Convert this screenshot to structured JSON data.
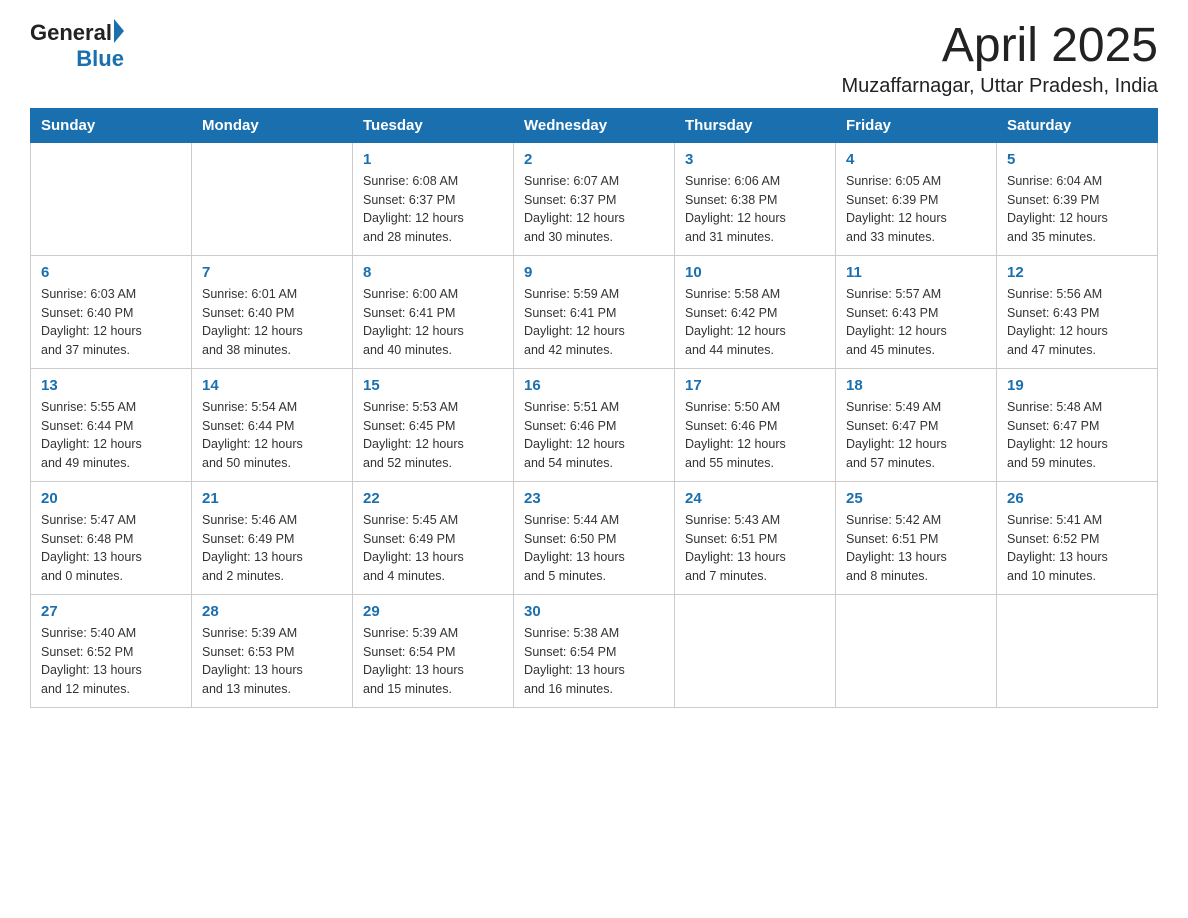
{
  "header": {
    "logo_general": "General",
    "logo_blue": "Blue",
    "title": "April 2025",
    "subtitle": "Muzaffarnagar, Uttar Pradesh, India"
  },
  "days_of_week": [
    "Sunday",
    "Monday",
    "Tuesday",
    "Wednesday",
    "Thursday",
    "Friday",
    "Saturday"
  ],
  "weeks": [
    [
      {
        "day": "",
        "info": ""
      },
      {
        "day": "",
        "info": ""
      },
      {
        "day": "1",
        "info": "Sunrise: 6:08 AM\nSunset: 6:37 PM\nDaylight: 12 hours\nand 28 minutes."
      },
      {
        "day": "2",
        "info": "Sunrise: 6:07 AM\nSunset: 6:37 PM\nDaylight: 12 hours\nand 30 minutes."
      },
      {
        "day": "3",
        "info": "Sunrise: 6:06 AM\nSunset: 6:38 PM\nDaylight: 12 hours\nand 31 minutes."
      },
      {
        "day": "4",
        "info": "Sunrise: 6:05 AM\nSunset: 6:39 PM\nDaylight: 12 hours\nand 33 minutes."
      },
      {
        "day": "5",
        "info": "Sunrise: 6:04 AM\nSunset: 6:39 PM\nDaylight: 12 hours\nand 35 minutes."
      }
    ],
    [
      {
        "day": "6",
        "info": "Sunrise: 6:03 AM\nSunset: 6:40 PM\nDaylight: 12 hours\nand 37 minutes."
      },
      {
        "day": "7",
        "info": "Sunrise: 6:01 AM\nSunset: 6:40 PM\nDaylight: 12 hours\nand 38 minutes."
      },
      {
        "day": "8",
        "info": "Sunrise: 6:00 AM\nSunset: 6:41 PM\nDaylight: 12 hours\nand 40 minutes."
      },
      {
        "day": "9",
        "info": "Sunrise: 5:59 AM\nSunset: 6:41 PM\nDaylight: 12 hours\nand 42 minutes."
      },
      {
        "day": "10",
        "info": "Sunrise: 5:58 AM\nSunset: 6:42 PM\nDaylight: 12 hours\nand 44 minutes."
      },
      {
        "day": "11",
        "info": "Sunrise: 5:57 AM\nSunset: 6:43 PM\nDaylight: 12 hours\nand 45 minutes."
      },
      {
        "day": "12",
        "info": "Sunrise: 5:56 AM\nSunset: 6:43 PM\nDaylight: 12 hours\nand 47 minutes."
      }
    ],
    [
      {
        "day": "13",
        "info": "Sunrise: 5:55 AM\nSunset: 6:44 PM\nDaylight: 12 hours\nand 49 minutes."
      },
      {
        "day": "14",
        "info": "Sunrise: 5:54 AM\nSunset: 6:44 PM\nDaylight: 12 hours\nand 50 minutes."
      },
      {
        "day": "15",
        "info": "Sunrise: 5:53 AM\nSunset: 6:45 PM\nDaylight: 12 hours\nand 52 minutes."
      },
      {
        "day": "16",
        "info": "Sunrise: 5:51 AM\nSunset: 6:46 PM\nDaylight: 12 hours\nand 54 minutes."
      },
      {
        "day": "17",
        "info": "Sunrise: 5:50 AM\nSunset: 6:46 PM\nDaylight: 12 hours\nand 55 minutes."
      },
      {
        "day": "18",
        "info": "Sunrise: 5:49 AM\nSunset: 6:47 PM\nDaylight: 12 hours\nand 57 minutes."
      },
      {
        "day": "19",
        "info": "Sunrise: 5:48 AM\nSunset: 6:47 PM\nDaylight: 12 hours\nand 59 minutes."
      }
    ],
    [
      {
        "day": "20",
        "info": "Sunrise: 5:47 AM\nSunset: 6:48 PM\nDaylight: 13 hours\nand 0 minutes."
      },
      {
        "day": "21",
        "info": "Sunrise: 5:46 AM\nSunset: 6:49 PM\nDaylight: 13 hours\nand 2 minutes."
      },
      {
        "day": "22",
        "info": "Sunrise: 5:45 AM\nSunset: 6:49 PM\nDaylight: 13 hours\nand 4 minutes."
      },
      {
        "day": "23",
        "info": "Sunrise: 5:44 AM\nSunset: 6:50 PM\nDaylight: 13 hours\nand 5 minutes."
      },
      {
        "day": "24",
        "info": "Sunrise: 5:43 AM\nSunset: 6:51 PM\nDaylight: 13 hours\nand 7 minutes."
      },
      {
        "day": "25",
        "info": "Sunrise: 5:42 AM\nSunset: 6:51 PM\nDaylight: 13 hours\nand 8 minutes."
      },
      {
        "day": "26",
        "info": "Sunrise: 5:41 AM\nSunset: 6:52 PM\nDaylight: 13 hours\nand 10 minutes."
      }
    ],
    [
      {
        "day": "27",
        "info": "Sunrise: 5:40 AM\nSunset: 6:52 PM\nDaylight: 13 hours\nand 12 minutes."
      },
      {
        "day": "28",
        "info": "Sunrise: 5:39 AM\nSunset: 6:53 PM\nDaylight: 13 hours\nand 13 minutes."
      },
      {
        "day": "29",
        "info": "Sunrise: 5:39 AM\nSunset: 6:54 PM\nDaylight: 13 hours\nand 15 minutes."
      },
      {
        "day": "30",
        "info": "Sunrise: 5:38 AM\nSunset: 6:54 PM\nDaylight: 13 hours\nand 16 minutes."
      },
      {
        "day": "",
        "info": ""
      },
      {
        "day": "",
        "info": ""
      },
      {
        "day": "",
        "info": ""
      }
    ]
  ]
}
